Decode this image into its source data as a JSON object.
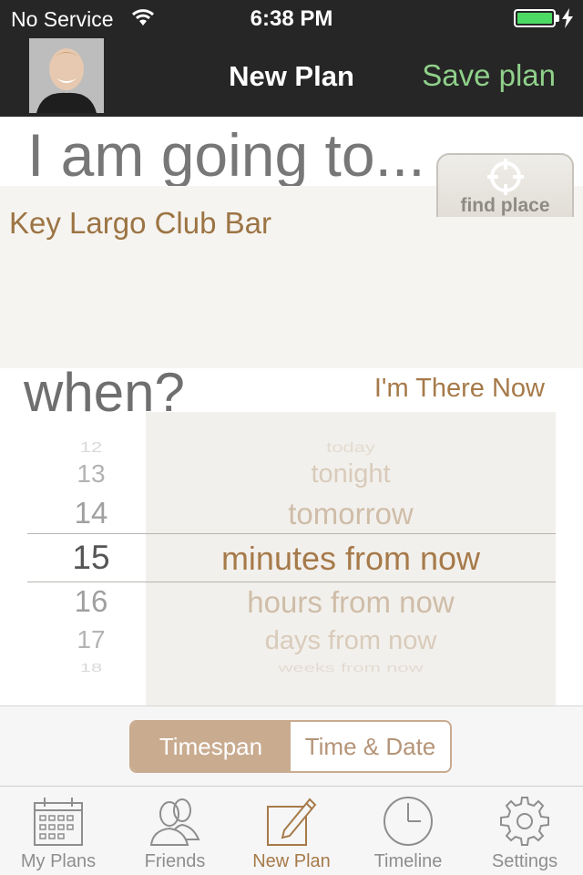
{
  "status_bar": {
    "carrier": "No Service",
    "time": "6:38 PM",
    "battery_color": "#4cd964"
  },
  "nav": {
    "title": "New Plan",
    "save_label": "Save plan",
    "avatar": "profile-photo"
  },
  "form": {
    "going_label": "I am going to...",
    "place_value": "Key Largo Club Bar",
    "find_place_label": "find place",
    "when_label": "when?",
    "im_there_now_label": "I'm There Now"
  },
  "picker": {
    "numbers": [
      "12",
      "13",
      "14",
      "15",
      "16",
      "17",
      "18"
    ],
    "units": [
      "today",
      "tonight",
      "tomorrow",
      "minutes from now",
      "hours from now",
      "days from now",
      "weeks from now"
    ],
    "selected_number": "15",
    "selected_unit": "minutes from now"
  },
  "segment": {
    "options": [
      "Timespan",
      "Time & Date"
    ],
    "selected": "Timespan"
  },
  "tabbar": {
    "items": [
      {
        "label": "My Plans",
        "icon": "calendar-icon"
      },
      {
        "label": "Friends",
        "icon": "friends-icon"
      },
      {
        "label": "New Plan",
        "icon": "compose-icon"
      },
      {
        "label": "Timeline",
        "icon": "clock-icon"
      },
      {
        "label": "Settings",
        "icon": "gear-icon"
      }
    ],
    "active": "New Plan"
  },
  "colors": {
    "accent": "#a67a4a",
    "save_green": "#8fd08a",
    "segment_active": "#c9ab90"
  }
}
